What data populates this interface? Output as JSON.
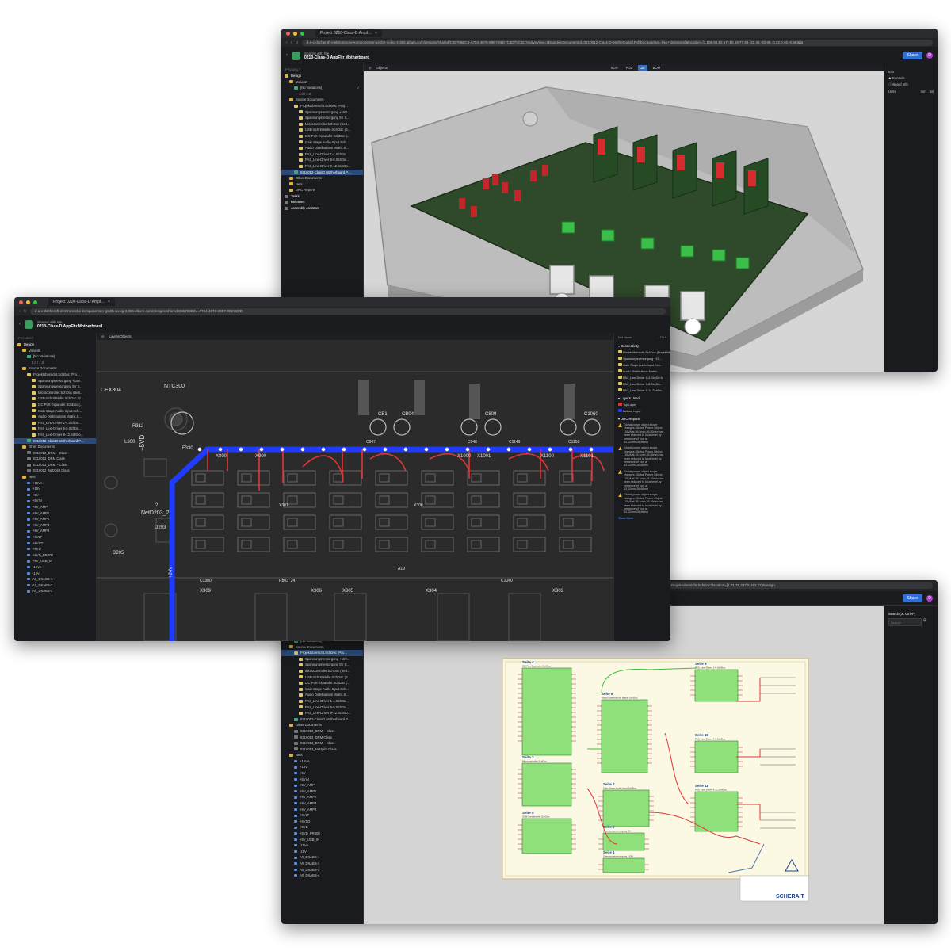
{
  "browser": {
    "tab_title": "Project 0210-Class-D Ampl…",
    "url_3d": "d-a-s-dscheraft-elektronische-komponenten-gmbh-co-kg-2.365.altium.com/designs/shared/C55769EC4-A764-4676-89E7-89E7C8D70C3C?activeView=3D&activeDocumentId=0210012-Class-D-Motherboard.PcbDoc&variant=[No+Variations]&location=[3,106.85,82.57,-10.68,77.84,-22.45,-93.95,-0.22,0.46,-0.86]&la",
    "url_pcb": "d-a-s-dscheraft-elektronische-komponenten-gmbh-co-kg-2.365.altium.com/designs/shared/C55769EC4-A764-4676-89E7-89E7C8D",
    "url_sch": "Projektubersicht.SchDoc?location=[1,71.78,237.6,163.27]#design"
  },
  "header": {
    "shared_with": "Shared with Me",
    "project_name": "0210-Class-D AppFltr Motherboard",
    "share_label": "Share",
    "avatar": "D"
  },
  "sidebar": {
    "section_label": "PROJECT",
    "design": "Design",
    "variants": "Variants",
    "no_variations": "[No Variations]",
    "variant_id": "1.0 / 1.0",
    "source_documents": "Source Documents",
    "projektubersicht": "Projektübersicht.SchDoc (Proj…",
    "projektubersicht_short": "Projektübersicht.SchDoc (Pro…",
    "docs_3d": [
      "Spannungsversorgung +15V...",
      "Spannungsversorgung 5V S...",
      "Microcontroller.SchDoc (Seit...",
      "USB-Schnittstelle.SchDoc (S...",
      "I2C Port-Expander.SchDoc (...",
      "Gain Stage Audio Input.Sch...",
      "Audio Distributions Matrix.S...",
      "PA3_Line-Driver 1-4.SchDo...",
      "PA3_Line-Driver 5-8.SchDo...",
      "PA3_Line-Driver 9-12.SchDo..."
    ],
    "motherboard": "0210012-ClassD Motherboard.P…",
    "other_documents": "Other Documents",
    "nets": "Nets",
    "drc_reports": "DRC Reports",
    "tasks": "Tasks",
    "releases": "Releases",
    "assembly_assistant": "Assembly Assistant",
    "other_docs_list": [
      "0210012_DRM – Class",
      "0210012_DRM Class",
      "0210012_DRM – Class",
      "0210012_Netzplot Class"
    ],
    "nets_list": [
      "+15VA",
      "+15V",
      "+5V",
      "+5VIN",
      "+5V_AMP",
      "+5V_AMP1",
      "+5V_AMP2",
      "+5V_AMP3",
      "+5V_AMP4",
      "+5VLT",
      "+5VSD",
      "+5VD",
      "+5VD_PR300",
      "+5V_USB_IN",
      "-15VA",
      "-15V",
      "A0_DSABB-1",
      "A0_DSABB-2",
      "A0_DSABB-3"
    ],
    "nets_list_sch": [
      "+15VA",
      "+15V",
      "+5V",
      "+5VIN",
      "+5V_AMP",
      "+5V_AMP1",
      "+5V_AMP2",
      "+5V_AMP3",
      "+5V_AMP4",
      "+5VLT",
      "+5VSD",
      "+5VD",
      "+5VD_PR300",
      "+5V_USB_IN",
      "-15VA",
      "-15V",
      "A0_DSABB-1",
      "A0_DSABB-2",
      "A0_DSABB-3",
      "A0_DSABB-4"
    ]
  },
  "toolbar": {
    "objects_label": "Objects",
    "layers_objects_label": "Layers/Objects",
    "views": [
      "SCH",
      "PCB",
      "3D",
      "BOM"
    ],
    "active_3d": "3D"
  },
  "panel3d": {
    "info": "Info",
    "controls": "Controls",
    "board_info": "Board Info",
    "units": "Units",
    "unit_mm": "mm",
    "unit_mil": "mil"
  },
  "pcbpanel": {
    "net_name": "Net Name",
    "net_value": "-15vA",
    "connectivity": "Connectivity",
    "connectivity_items": [
      "Projektübersicht.SchDoc (Projektüb…",
      "Spannungsversorgung +15...",
      "Gain Stage Audio Input.Sch...",
      "Audio Distributions Matrix...",
      "PA3_Line-Driver 1-4.SchDo M",
      "PA3_Line-Driver 5-8.SchDo...",
      "PA3_Line-Driver 9-12.SchDo..."
    ],
    "layers_used": "Layers Used",
    "top_layer": "Top Layer",
    "bottom_layer": "Bottom Layer",
    "drc_reports": "DRC Reports",
    "drc_items": [
      "Global power object scope changes: Global Power Object -15VA at 56.5mm,26.92mm has been reduced to local level by presence of port at 33.32mm,26.46mm",
      "Global power object scope changes: Global Power Object -15VA at 46.1mm,26.46mm has been reduced to local level by presence of port at 33.32mm,26.46mm",
      "Global power object scope changes: Global Power Object -15VA at 38.1mm,26.46mm has been reduced to local level by presence of port at 33.32mm,26.46mm",
      "Global power object scope changes: Global Power Object -15VA at 38.1mm,26.46mm has been reduced to local level by presence of port at 33.32mm,26.46mm"
    ],
    "show_more": "Show More"
  },
  "schpanel": {
    "search_title": "Search (⌘ Ctrl+F)",
    "search_placeholder": "Search"
  },
  "pcb_labels": {
    "ntc": "NTC300",
    "cex": "CEX304",
    "plus5v": "+5VD",
    "net": "NetD203_2",
    "two": "2",
    "l300": "L300",
    "f330": "F330",
    "r312": "R312",
    "d203": "D203",
    "d205": "D205",
    "x301": "X301",
    "x303": "X303",
    "x304": "X304",
    "x305": "X305",
    "x306": "X306",
    "x308": "X308",
    "x309": "X309",
    "x800": "X800",
    "x900": "X900",
    "x1000": "X1000",
    "x1001": "X1001",
    "x1100": "X1100",
    "x1101": "X1101",
    "cb1": "CB1",
    "cb04": "CB04",
    "c809": "C809",
    "c1060": "C1060",
    "c947": "C947",
    "c948": "C948",
    "c1149": "C1149",
    "c1150": "C1150",
    "r803": "R803_24",
    "c1040": "C1040",
    "c3300": "C3300",
    "a19": "A19",
    "v24": "+24V"
  },
  "schematic": {
    "sheets": [
      {
        "title": "Seite 4",
        "sub": "I2C Port-Expander.SchDoc"
      },
      {
        "title": "Seite 6",
        "sub": "Audio Distributions Matrix.SchDoc"
      },
      {
        "title": "Seite 7",
        "sub": "Gain Stage Audio Input.SchDoc"
      },
      {
        "title": "Seite 3",
        "sub": "Microcontroller.SchDoc"
      },
      {
        "title": "Seite 5",
        "sub": "USB-Schnittstelle.SchDoc"
      },
      {
        "title": "Seite 2",
        "sub": "Spannungsversorgung 5V"
      },
      {
        "title": "Seite 1",
        "sub": "Spannungsversorgung +15V"
      },
      {
        "title": "Seite 9",
        "sub": "PA3_Line-Driver 1-4.SchDoc"
      },
      {
        "title": "Seite 10",
        "sub": "PA3_Line-Driver 5-8.SchDoc"
      },
      {
        "title": "Seite 11",
        "sub": "PA3_Line-Driver 9-12.SchDoc"
      }
    ],
    "logo": "SCHERAIT"
  },
  "colors": {
    "accent": "#2f6fd8",
    "pcb_green": "#2f4a2a",
    "sheet_green": "#8fe07a",
    "net_red": "#e23636",
    "net_blue": "#1f3bff"
  }
}
